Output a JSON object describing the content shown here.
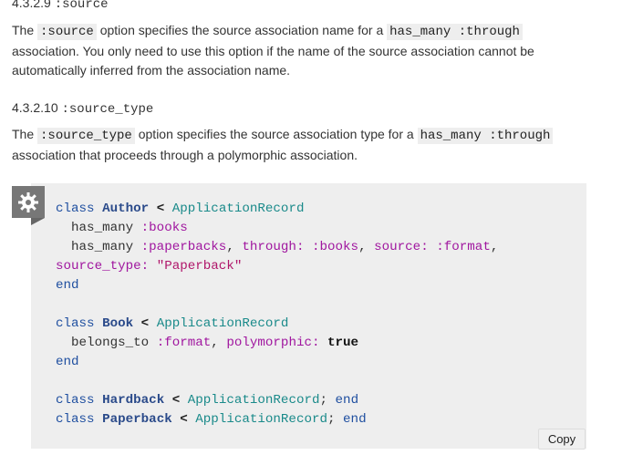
{
  "section_source": {
    "number": "4.3.2.9",
    "option": ":source",
    "para_before": "The ",
    "para_code": ":source",
    "para_mid": " option specifies the source association name for a ",
    "para_code2": "has_many :through",
    "para_after": " association. You only need to use this option if the name of the source association cannot be automatically inferred from the association name."
  },
  "section_source_type": {
    "number": "4.3.2.10",
    "option": ":source_type",
    "para_before": "The ",
    "para_code": ":source_type",
    "para_mid": " option specifies the source association type for a ",
    "para_code2": "has_many :through",
    "para_after": " association that proceeds through a polymorphic association."
  },
  "code": {
    "lines": [
      "class Author < ApplicationRecord",
      "  has_many :books",
      "  has_many :paperbacks, through: :books, source: :format,",
      "source_type: \"Paperback\"",
      "end",
      "",
      "class Book < ApplicationRecord",
      "  belongs_to :format, polymorphic: true",
      "end",
      "",
      "class Hardback < ApplicationRecord; end",
      "class Paperback < ApplicationRecord; end"
    ],
    "copy_label": "Copy"
  }
}
